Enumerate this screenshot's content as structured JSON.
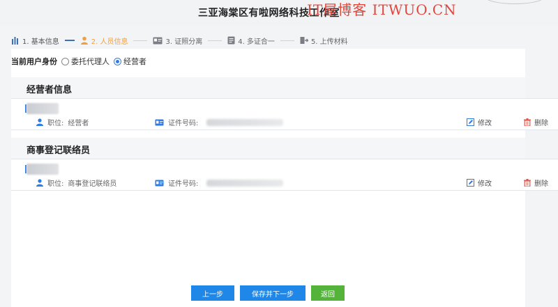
{
  "header": {
    "title": "三亚海棠区有啦网络科技工作室",
    "watermark": "IT屋博客 ITWUO.CN"
  },
  "steps": [
    {
      "label": "1. 基本信息",
      "icon": "chart-bar-icon",
      "state": "done"
    },
    {
      "label": "2. 人员信息",
      "icon": "person-icon",
      "state": "active"
    },
    {
      "label": "3. 证照分离",
      "icon": "card-icon",
      "state": "pending"
    },
    {
      "label": "4. 多证合一",
      "icon": "file-icon",
      "state": "pending"
    },
    {
      "label": "5. 上传材料",
      "icon": "upload-icon",
      "state": "pending"
    }
  ],
  "identity": {
    "label": "当前用户身份",
    "options": [
      {
        "label": "委托代理人",
        "selected": false
      },
      {
        "label": "经营者",
        "selected": true
      }
    ]
  },
  "sections": [
    {
      "title": "经营者信息",
      "person": {
        "position_label": "职位:",
        "position_value": "经营者",
        "cert_label": "证件号码:",
        "edit_label": "修改",
        "delete_label": "删除"
      }
    },
    {
      "title": "商事登记联络员",
      "person": {
        "position_label": "职位:",
        "position_value": "商事登记联络员",
        "cert_label": "证件号码:",
        "edit_label": "修改",
        "delete_label": "删除"
      }
    }
  ],
  "buttons": {
    "prev": "上一步",
    "save_next": "保存并下一步",
    "back": "返回"
  },
  "colors": {
    "accent": "#1f87e8",
    "active_step": "#f0a040",
    "radio_on": "#2d7be5",
    "back_button": "#54b43a",
    "delete_icon": "#e2574c",
    "watermark": "#e0473c"
  }
}
